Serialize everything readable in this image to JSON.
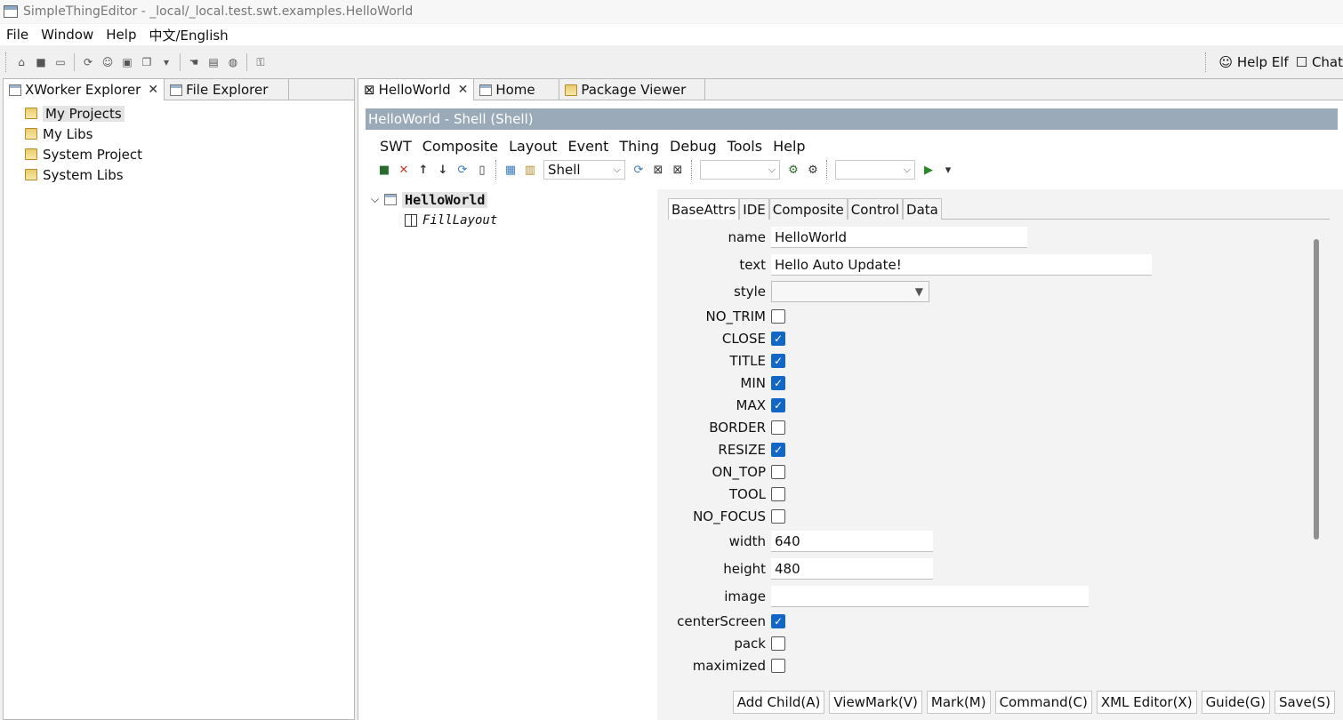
{
  "window": {
    "title": "SimpleThingEditor - _local/_local.test.swt.examples.HelloWorld"
  },
  "menu": [
    "File",
    "Window",
    "Help",
    "中文/English"
  ],
  "toolbar_right": {
    "help_elf": "Help Elf",
    "chat": "Chat"
  },
  "left_panel": {
    "tabs": [
      {
        "label": "XWorker Explorer"
      },
      {
        "label": "File Explorer"
      }
    ],
    "tree": [
      "My Projects",
      "My Libs",
      "System Project",
      "System Libs"
    ]
  },
  "editor_tabs": [
    {
      "label": "HelloWorld"
    },
    {
      "label": "Home"
    },
    {
      "label": "Package Viewer"
    }
  ],
  "shell_header": "HelloWorld - Shell  (Shell)",
  "inner_menu": [
    "SWT",
    "Composite",
    "Layout",
    "Event",
    "Thing",
    "Debug",
    "Tools",
    "Help"
  ],
  "inner_toolbar": {
    "type_combo": "Shell",
    "combo2": "",
    "combo3": ""
  },
  "thing_tree": {
    "root": "HelloWorld",
    "child": "FillLayout"
  },
  "prop_tabs": [
    "BaseAttrs",
    "IDE",
    "Composite",
    "Control",
    "Data"
  ],
  "fields": {
    "name": {
      "label": "name",
      "value": "HelloWorld"
    },
    "text": {
      "label": "text",
      "value": "Hello Auto Update!"
    },
    "style": {
      "label": "style",
      "value": ""
    },
    "width": {
      "label": "width",
      "value": "640"
    },
    "height": {
      "label": "height",
      "value": "480"
    },
    "image": {
      "label": "image",
      "value": ""
    }
  },
  "checkboxes": [
    {
      "label": "NO_TRIM",
      "checked": false
    },
    {
      "label": "CLOSE",
      "checked": true
    },
    {
      "label": "TITLE",
      "checked": true
    },
    {
      "label": "MIN",
      "checked": true
    },
    {
      "label": "MAX",
      "checked": true
    },
    {
      "label": "BORDER",
      "checked": false
    },
    {
      "label": "RESIZE",
      "checked": true
    },
    {
      "label": "ON_TOP",
      "checked": false
    },
    {
      "label": "TOOL",
      "checked": false
    },
    {
      "label": "NO_FOCUS",
      "checked": false
    }
  ],
  "checkboxes2": [
    {
      "label": "centerScreen",
      "checked": true
    },
    {
      "label": "pack",
      "checked": false
    },
    {
      "label": "maximized",
      "checked": false
    }
  ],
  "buttons": [
    "Add Child(A)",
    "ViewMark(V)",
    "Mark(M)",
    "Command(C)",
    "XML Editor(X)",
    "Guide(G)",
    "Save(S)"
  ]
}
